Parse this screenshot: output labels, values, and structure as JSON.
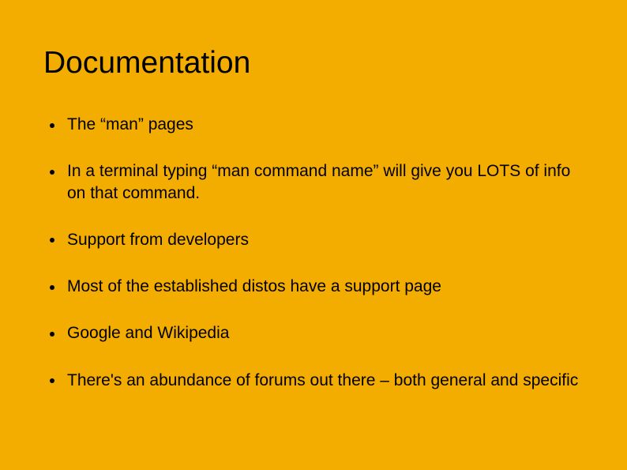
{
  "title": "Documentation",
  "bullets": [
    {
      "text": "The “man” pages"
    },
    {
      "text": " In a terminal typing “man command name” will give you LOTS of info   on that command."
    },
    {
      "text": "Support from developers"
    },
    {
      "text": "Most of the established distos have a support page"
    },
    {
      "text": "Google and Wikipedia"
    },
    {
      "text": "There's an abundance of forums out there – both general and specific"
    }
  ]
}
